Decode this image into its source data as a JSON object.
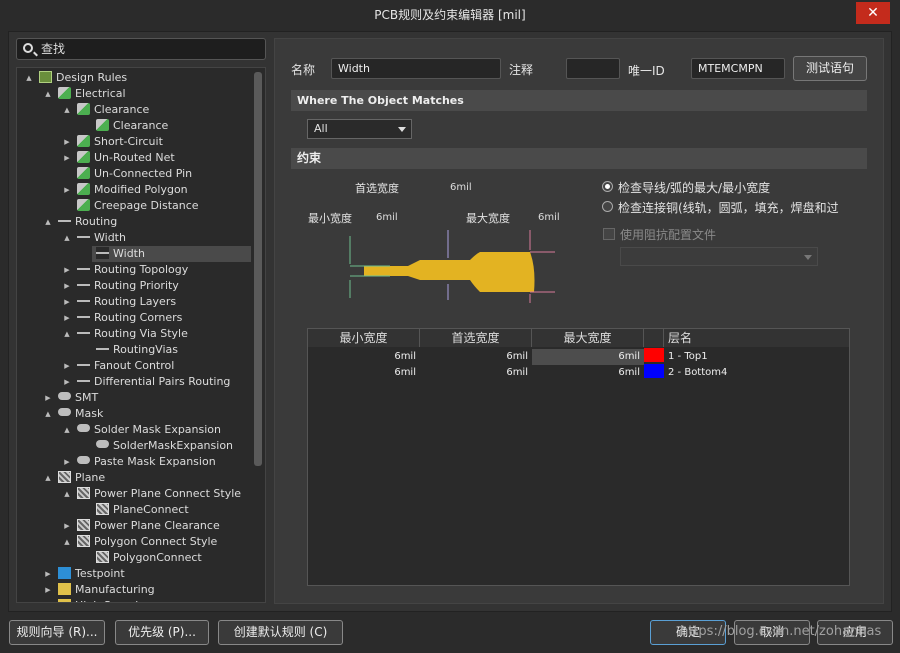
{
  "window": {
    "title": "PCB规则及约束编辑器 [mil]",
    "close": "✕"
  },
  "search": {
    "placeholder": "查找"
  },
  "tree": [
    {
      "label": "Design Rules",
      "indent": 0,
      "icon": "rules",
      "tw": "▲"
    },
    {
      "label": "Electrical",
      "indent": 1,
      "icon": "green",
      "tw": "▲"
    },
    {
      "label": "Clearance",
      "indent": 2,
      "icon": "green",
      "tw": "▲"
    },
    {
      "label": "Clearance",
      "indent": 3,
      "icon": "green",
      "tw": ""
    },
    {
      "label": "Short-Circuit",
      "indent": 2,
      "icon": "green",
      "tw": "▶"
    },
    {
      "label": "Un-Routed Net",
      "indent": 2,
      "icon": "green",
      "tw": "▶"
    },
    {
      "label": "Un-Connected Pin",
      "indent": 2,
      "icon": "green",
      "tw": ""
    },
    {
      "label": "Modified Polygon",
      "indent": 2,
      "icon": "green",
      "tw": "▶"
    },
    {
      "label": "Creepage Distance",
      "indent": 2,
      "icon": "green",
      "tw": ""
    },
    {
      "label": "Routing",
      "indent": 1,
      "icon": "route",
      "tw": "▲"
    },
    {
      "label": "Width",
      "indent": 2,
      "icon": "route",
      "tw": "▲"
    },
    {
      "label": "Width",
      "indent": 3,
      "icon": "route",
      "tw": "",
      "sel": true
    },
    {
      "label": "Routing Topology",
      "indent": 2,
      "icon": "route",
      "tw": "▶"
    },
    {
      "label": "Routing Priority",
      "indent": 2,
      "icon": "route",
      "tw": "▶"
    },
    {
      "label": "Routing Layers",
      "indent": 2,
      "icon": "route",
      "tw": "▶"
    },
    {
      "label": "Routing Corners",
      "indent": 2,
      "icon": "route",
      "tw": "▶"
    },
    {
      "label": "Routing Via Style",
      "indent": 2,
      "icon": "route",
      "tw": "▲"
    },
    {
      "label": "RoutingVias",
      "indent": 3,
      "icon": "route",
      "tw": ""
    },
    {
      "label": "Fanout Control",
      "indent": 2,
      "icon": "route",
      "tw": "▶"
    },
    {
      "label": "Differential Pairs Routing",
      "indent": 2,
      "icon": "route",
      "tw": "▶"
    },
    {
      "label": "SMT",
      "indent": 1,
      "icon": "pad",
      "tw": "▶"
    },
    {
      "label": "Mask",
      "indent": 1,
      "icon": "pad",
      "tw": "▲"
    },
    {
      "label": "Solder Mask Expansion",
      "indent": 2,
      "icon": "pad",
      "tw": "▲"
    },
    {
      "label": "SolderMaskExpansion",
      "indent": 3,
      "icon": "pad",
      "tw": ""
    },
    {
      "label": "Paste Mask Expansion",
      "indent": 2,
      "icon": "pad",
      "tw": "▶"
    },
    {
      "label": "Plane",
      "indent": 1,
      "icon": "plane",
      "tw": "▲"
    },
    {
      "label": "Power Plane Connect Style",
      "indent": 2,
      "icon": "plane",
      "tw": "▲"
    },
    {
      "label": "PlaneConnect",
      "indent": 3,
      "icon": "plane",
      "tw": ""
    },
    {
      "label": "Power Plane Clearance",
      "indent": 2,
      "icon": "plane",
      "tw": "▶"
    },
    {
      "label": "Polygon Connect Style",
      "indent": 2,
      "icon": "plane",
      "tw": "▲"
    },
    {
      "label": "PolygonConnect",
      "indent": 3,
      "icon": "plane",
      "tw": ""
    },
    {
      "label": "Testpoint",
      "indent": 1,
      "icon": "tp",
      "tw": "▶"
    },
    {
      "label": "Manufacturing",
      "indent": 1,
      "icon": "mfg",
      "tw": "▶"
    },
    {
      "label": "High Speed",
      "indent": 1,
      "icon": "mfg",
      "tw": "▶"
    }
  ],
  "rule": {
    "name_label": "名称",
    "name": "Width",
    "comment_label": "注释",
    "comment": "",
    "id_label": "唯一ID",
    "id": "MTEMCMPN",
    "test_btn": "测试语句"
  },
  "match": {
    "header": "Where The Object Matches",
    "scope": "All"
  },
  "constraints": {
    "header": "约束",
    "pref_label": "首选宽度",
    "pref": "6mil",
    "min_label": "最小宽度",
    "min": "6mil",
    "max_label": "最大宽度",
    "max": "6mil",
    "radio1": "检查导线/弧的最大/最小宽度",
    "radio2": "检查连接铜(线轨，圆弧，填充，焊盘和过",
    "impedance": "使用阻抗配置文件"
  },
  "table": {
    "headers": [
      "最小宽度",
      "首选宽度",
      "最大宽度",
      "层名"
    ],
    "rows": [
      {
        "min": "6mil",
        "pref": "6mil",
        "max": "6mil",
        "color": "#ff0000",
        "layer": "1 - Top1"
      },
      {
        "min": "6mil",
        "pref": "6mil",
        "max": "6mil",
        "color": "#0000ff",
        "layer": "2 - Bottom4"
      }
    ]
  },
  "buttons": {
    "wizard": "规则向导 (R)...",
    "priority": "优先级 (P)...",
    "defaults": "创建默认规则 (C)",
    "ok": "确定",
    "cancel": "取消",
    "apply": "应用"
  },
  "watermark": "https://blog.csdn.net/zohanhas"
}
